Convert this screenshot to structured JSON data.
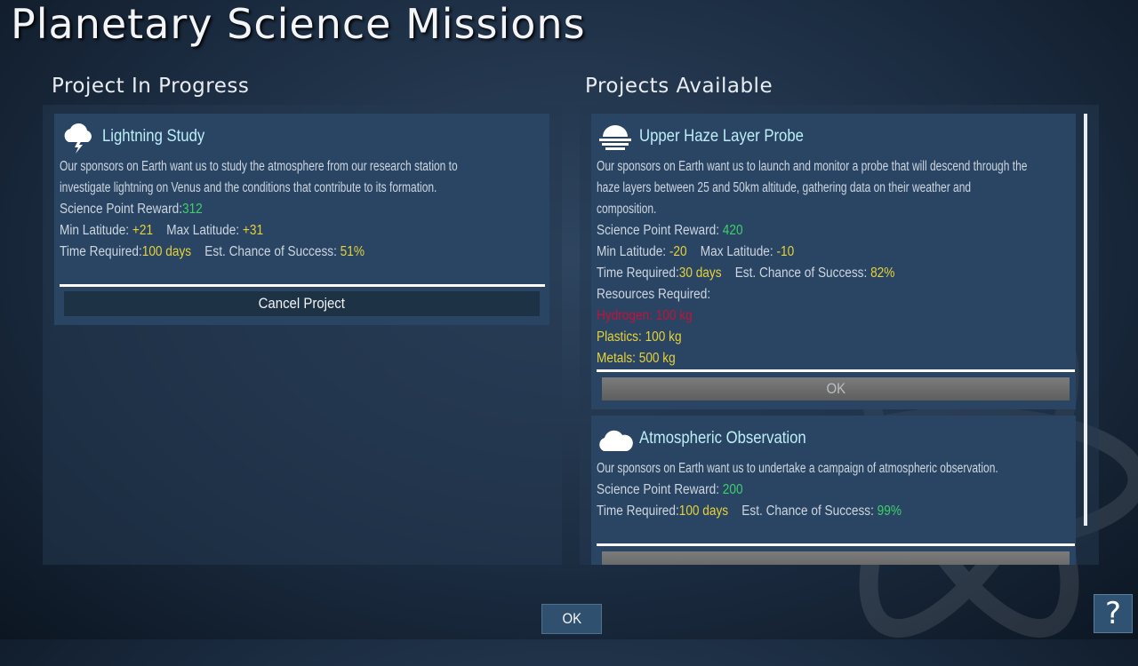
{
  "title": "Planetary Science Missions",
  "in_progress": {
    "heading": "Project In Progress",
    "project": {
      "icon": "lightning-cloud-icon",
      "name": "Lightning Study",
      "description_lines": [
        "Our sponsors on Earth want us to study the atmosphere from our research station to",
        "investigate lightning on Venus and the conditions that contribute to its formation."
      ],
      "reward_label": "Science Point Reward:",
      "reward": "312",
      "min_lat_label": "Min Latitude:",
      "min_lat": "+21",
      "max_lat_label": "Max Latitude:",
      "max_lat": "+31",
      "time_label": "Time Required:",
      "time": "100 days",
      "chance_label": "Est. Chance of Success:",
      "chance": "51%",
      "cancel_label": "Cancel Project"
    }
  },
  "available": {
    "heading": "Projects Available",
    "projects": [
      {
        "icon": "haze-layers-icon",
        "name": "Upper Haze Layer Probe",
        "description_lines": [
          "Our sponsors on Earth want us to launch and monitor a probe that will descend through the",
          "haze layers between 25 and 50km altitude, gathering data on their weather and",
          "composition."
        ],
        "reward_label": "Science Point Reward:",
        "reward": "420",
        "min_lat_label": "Min Latitude:",
        "min_lat": "-20",
        "max_lat_label": "Max Latitude:",
        "max_lat": "-10",
        "time_label": "Time Required:",
        "time": "30 days",
        "chance_label": "Est. Chance of Success:",
        "chance": "82%",
        "resources_label": "Resources Required:",
        "resources": [
          {
            "text": "Hydrogen: 100 kg",
            "color": "#c4123a"
          },
          {
            "text": "Plastics: 100 kg",
            "color": "#e6d23a"
          },
          {
            "text": "Metals: 500 kg",
            "color": "#e6d23a"
          }
        ],
        "ok_label": "OK"
      },
      {
        "icon": "cloud-icon",
        "name": "Atmospheric Observation",
        "description_lines": [
          "Our sponsors on Earth want us to undertake a campaign of atmospheric observation."
        ],
        "reward_label": "Science Point Reward:",
        "reward": "200",
        "time_label": "Time Required:",
        "time": "100 days",
        "chance_label": "Est. Chance of Success:",
        "chance": "99%"
      }
    ]
  },
  "ok_label": "OK",
  "help_label": "?",
  "colors": {
    "green": "#3dd16a",
    "yellow": "#e6d23a",
    "red": "#c4123a",
    "title_cyan": "#bdeef7"
  }
}
